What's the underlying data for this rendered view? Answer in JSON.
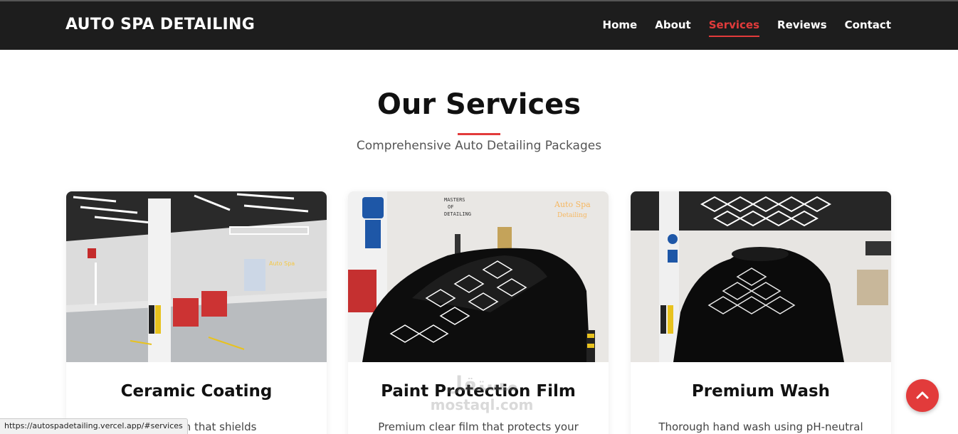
{
  "navbar": {
    "brand": "AUTO SPA DETAILING",
    "links": [
      {
        "label": "Home"
      },
      {
        "label": "About"
      },
      {
        "label": "Services"
      },
      {
        "label": "Reviews"
      },
      {
        "label": "Contact"
      }
    ],
    "active_link": "Services"
  },
  "services_section": {
    "title": "Our Services",
    "subtitle": "Comprehensive Auto Detailing Packages",
    "cards": [
      {
        "title": "Ceramic Coating",
        "description": "protection that shields"
      },
      {
        "title": "Paint Protection Film",
        "description": "Premium clear film that protects your"
      },
      {
        "title": "Premium Wash",
        "description": "Thorough hand wash using pH-neutral"
      }
    ]
  },
  "scroll_top": {
    "icon": "chevron-up-icon"
  },
  "status_bar": {
    "url": "https://autospadetailing.vercel.app/#services"
  },
  "watermark": {
    "arabic": "مستقل",
    "latin": "mostaql.com"
  },
  "colors": {
    "accent": "#e23b3b",
    "navbar_bg": "#1d1d1d"
  }
}
